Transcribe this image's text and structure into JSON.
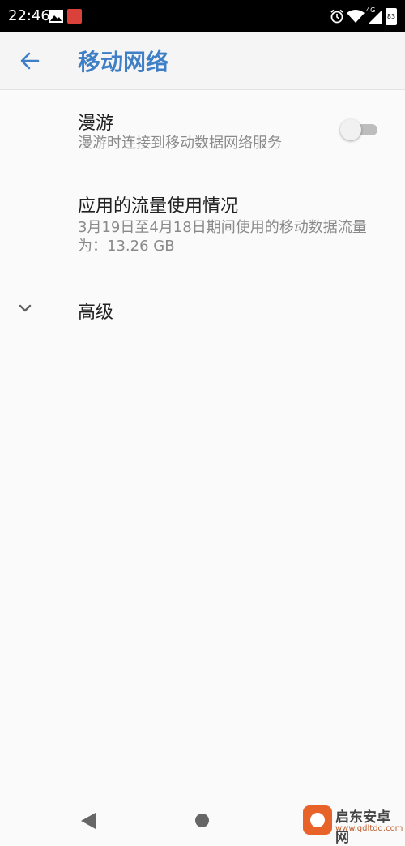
{
  "status_bar": {
    "time": "22:46",
    "network": "4G",
    "battery": "83",
    "icons": [
      "image-icon",
      "app-icon",
      "alarm-icon",
      "wifi-icon",
      "cellular-signal-icon",
      "battery-icon"
    ]
  },
  "app_bar": {
    "title": "移动网络",
    "back_icon": "arrow-back-icon"
  },
  "preferences": {
    "roaming": {
      "title": "漫游",
      "summary": "漫游时连接到移动数据网络服务",
      "enabled": false
    },
    "app_usage": {
      "title": "应用的流量使用情况",
      "summary": "3月19日至4月18日期间使用的移动数据流量为：13.26 GB"
    },
    "advanced": {
      "title": "高级",
      "icon": "chevron-down-icon"
    }
  },
  "nav_bar": {
    "icons": [
      "nav-back-icon",
      "nav-home-icon"
    ]
  },
  "watermark": {
    "text": "启东安卓网",
    "url": "www.qdltdq.com"
  },
  "colors": {
    "accent": "#3f7fc7",
    "background": "#fafafa",
    "status_bar": "#000000",
    "summary_text": "#8a8a8a"
  }
}
